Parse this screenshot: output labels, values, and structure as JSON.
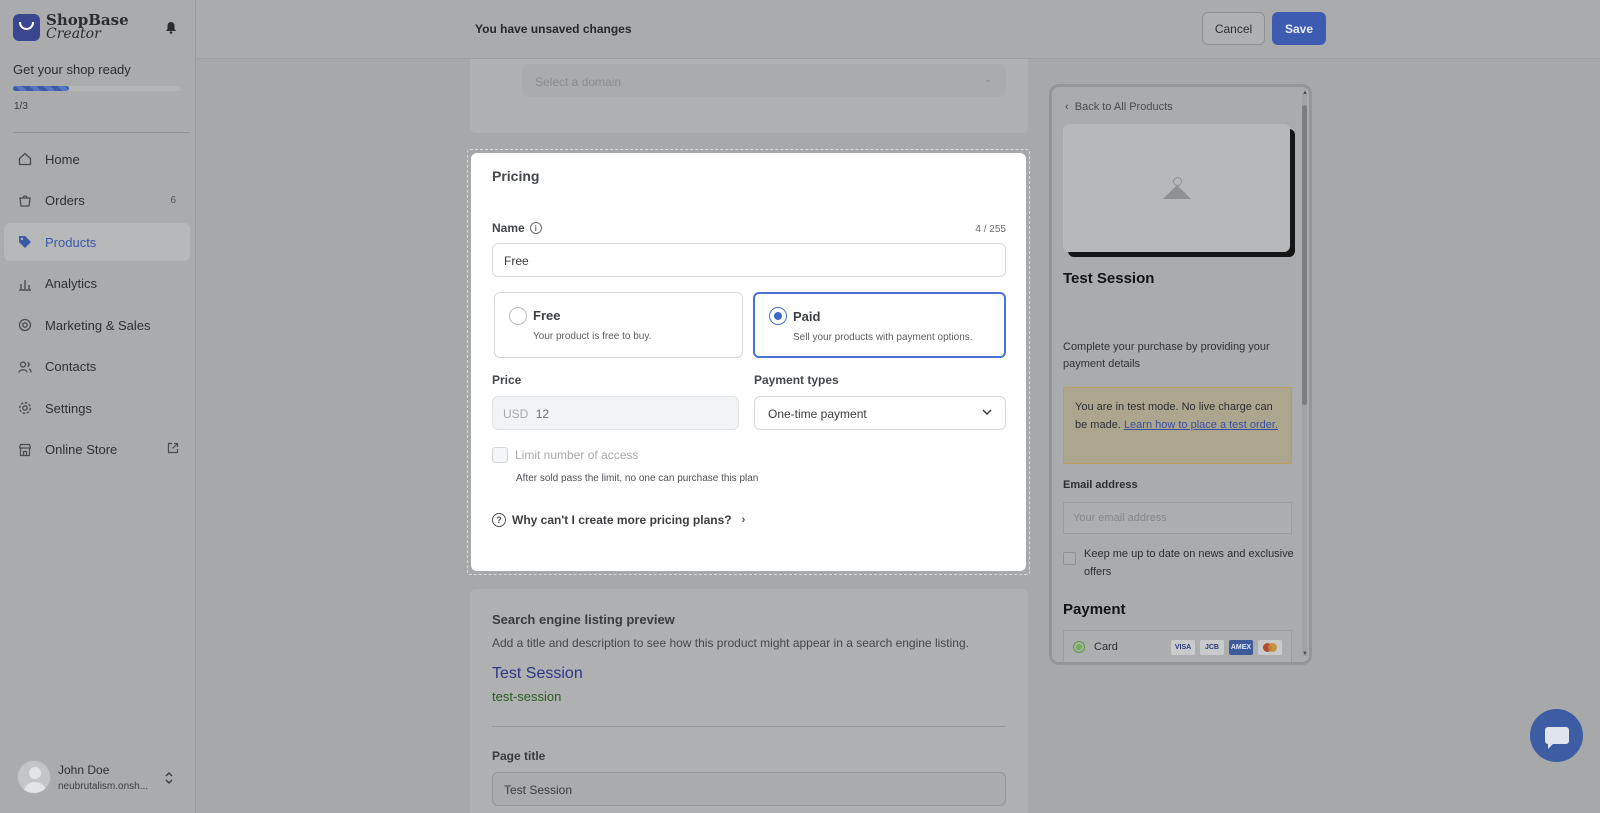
{
  "brand": {
    "name": "ShopBase",
    "sub": "Creator"
  },
  "sidebar": {
    "ready_title": "Get your shop ready",
    "progress": {
      "label": "1/3",
      "fraction": 0.333
    },
    "items": [
      {
        "label": "Home",
        "icon": "home-icon"
      },
      {
        "label": "Orders",
        "icon": "orders-icon",
        "count": "6"
      },
      {
        "label": "Products",
        "icon": "tag-icon",
        "active": true
      },
      {
        "label": "Analytics",
        "icon": "analytics-icon"
      },
      {
        "label": "Marketing & Sales",
        "icon": "target-icon"
      },
      {
        "label": "Contacts",
        "icon": "contacts-icon"
      },
      {
        "label": "Settings",
        "icon": "gear-icon"
      },
      {
        "label": "Online Store",
        "icon": "store-icon"
      }
    ],
    "user": {
      "name": "John Doe",
      "domain": "neubrutalism.onsh..."
    }
  },
  "topbar": {
    "message": "You have unsaved changes",
    "cancel": "Cancel",
    "save": "Save"
  },
  "domain": {
    "placeholder": "Select a domain"
  },
  "pricing": {
    "title": "Pricing",
    "name_label": "Name",
    "name_count": "4 / 255",
    "name_value": "Free",
    "options": {
      "free": {
        "title": "Free",
        "desc": "Your product is free to buy."
      },
      "paid": {
        "title": "Paid",
        "desc": "Sell your products with payment options."
      }
    },
    "selected": "paid",
    "price_label": "Price",
    "currency": "USD",
    "price_value": "12",
    "payment_types_label": "Payment types",
    "payment_type_value": "One-time payment",
    "limit_label": "Limit number of access",
    "limit_help": "After sold pass the limit, no one can purchase this plan",
    "why_link": "Why can't I create more pricing plans?"
  },
  "seo": {
    "title": "Search engine listing preview",
    "desc": "Add a title and description to see how this product might appear in a search engine listing.",
    "link_title": "Test Session",
    "slug": "test-session",
    "page_title_label": "Page title",
    "page_title_value": "Test Session"
  },
  "preview": {
    "back": "Back to All Products",
    "product_title": "Test Session",
    "complete": "Complete your purchase by providing your payment details",
    "notice": "You are in test mode. No live charge can be made.",
    "notice_link": "Learn how to place a test order.",
    "email_label": "Email address",
    "email_placeholder": "Your email address",
    "keep_label": "Keep me up to date on news and exclusive offers",
    "payment_title": "Payment",
    "card_label": "Card",
    "brands": [
      "VISA",
      "JCB",
      "AMEX",
      "MC"
    ]
  },
  "colors": {
    "accent": "#3d5cb1",
    "selected_border": "#4a72d4",
    "chat": "#3d5ca3"
  }
}
